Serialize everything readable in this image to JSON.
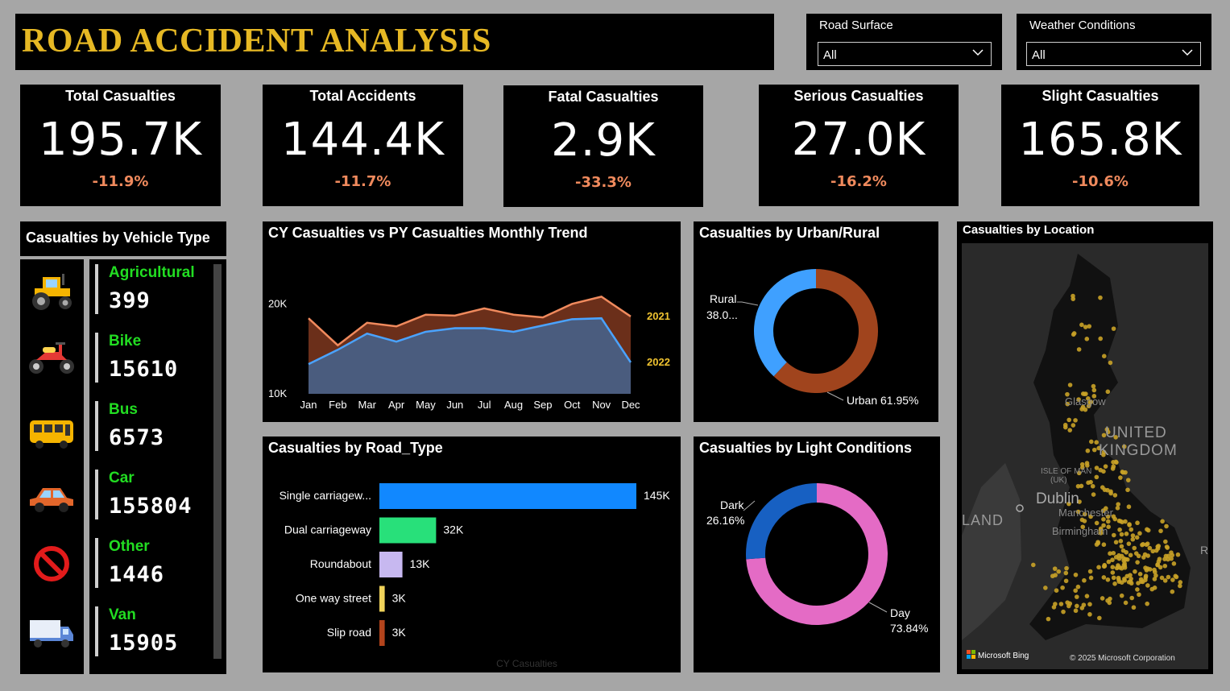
{
  "title": "ROAD ACCIDENT ANALYSIS",
  "slicers": [
    {
      "label": "Road Surface",
      "value": "All"
    },
    {
      "label": "Weather Conditions",
      "value": "All"
    }
  ],
  "kpis": [
    {
      "title": "Total Casualties",
      "value": "195.7K",
      "change": "-11.9%"
    },
    {
      "title": "Total Accidents",
      "value": "144.4K",
      "change": "-11.7%"
    },
    {
      "title": "Fatal Casualties",
      "value": "2.9K",
      "change": "-33.3%"
    },
    {
      "title": "Serious Casualties",
      "value": "27.0K",
      "change": "-16.2%"
    },
    {
      "title": "Slight Casualties",
      "value": "165.8K",
      "change": "-10.6%"
    }
  ],
  "vehicle_type": {
    "title": "Casualties by Vehicle Type",
    "items": [
      {
        "name": "Agricultural",
        "value": "399",
        "icon": "tractor-icon"
      },
      {
        "name": "Bike",
        "value": "15610",
        "icon": "motorbike-icon"
      },
      {
        "name": "Bus",
        "value": "6573",
        "icon": "bus-icon"
      },
      {
        "name": "Car",
        "value": "155804",
        "icon": "car-icon"
      },
      {
        "name": "Other",
        "value": "1446",
        "icon": "prohibited-icon"
      },
      {
        "name": "Van",
        "value": "15905",
        "icon": "van-icon"
      }
    ]
  },
  "chart_data": [
    {
      "type": "area",
      "title": "CY Casualties vs PY Casualties Monthly Trend",
      "x": [
        "Jan",
        "Feb",
        "Mar",
        "Apr",
        "May",
        "Jun",
        "Jul",
        "Aug",
        "Sep",
        "Oct",
        "Nov",
        "Dec"
      ],
      "ylim": [
        10000,
        22000
      ],
      "yticks": [
        "20K",
        "10K"
      ],
      "ytick_values": [
        20000,
        10000
      ],
      "series": [
        {
          "name": "2021",
          "values": [
            18400,
            15400,
            17900,
            17500,
            18800,
            18700,
            19500,
            18800,
            18500,
            20000,
            20800,
            18600
          ],
          "color": "#f08a5d"
        },
        {
          "name": "2022",
          "values": [
            13300,
            14900,
            16700,
            15800,
            16900,
            17300,
            17300,
            16900,
            17600,
            18300,
            18400,
            13500
          ],
          "color": "#4aa3ff"
        }
      ]
    },
    {
      "type": "pie",
      "title": "Casualties by Urban/Rural",
      "slices": [
        {
          "label": "Urban",
          "value": 61.95,
          "display": "Urban 61.95%",
          "color": "#a0441d"
        },
        {
          "label": "Rural",
          "value": 38.05,
          "display": "38.0...",
          "color": "#3fa0ff"
        }
      ]
    },
    {
      "type": "bar",
      "title": "Casualties by Road_Type",
      "xlabel": "CY Casualties",
      "categories": [
        "Single carriagew...",
        "Dual carriageway",
        "Roundabout",
        "One way street",
        "Slip road"
      ],
      "values": [
        145,
        32,
        13,
        3,
        3
      ],
      "labels": [
        "145K",
        "32K",
        "13K",
        "3K",
        "3K"
      ],
      "colors": [
        "#1188ff",
        "#28e07a",
        "#c7b8f0",
        "#f0d35a",
        "#b3441c"
      ]
    },
    {
      "type": "pie",
      "title": "Casualties by Light Conditions",
      "slices": [
        {
          "label": "Day",
          "value": 73.84,
          "display": "73.84%",
          "color": "#e46bc5"
        },
        {
          "label": "Dark",
          "value": 26.16,
          "display": "26.16%",
          "color": "#1760c2"
        }
      ]
    }
  ],
  "map": {
    "title": "Casualties by Location",
    "labels": [
      "Glasgow",
      "UNITED",
      "KINGDOM",
      "ISLE OF MAN",
      "(UK)",
      "Dublin",
      "Manchester",
      "Birmingham",
      "LAND",
      "R"
    ],
    "brand": "Microsoft Bing",
    "copyright": "© 2025 Microsoft Corporation"
  }
}
